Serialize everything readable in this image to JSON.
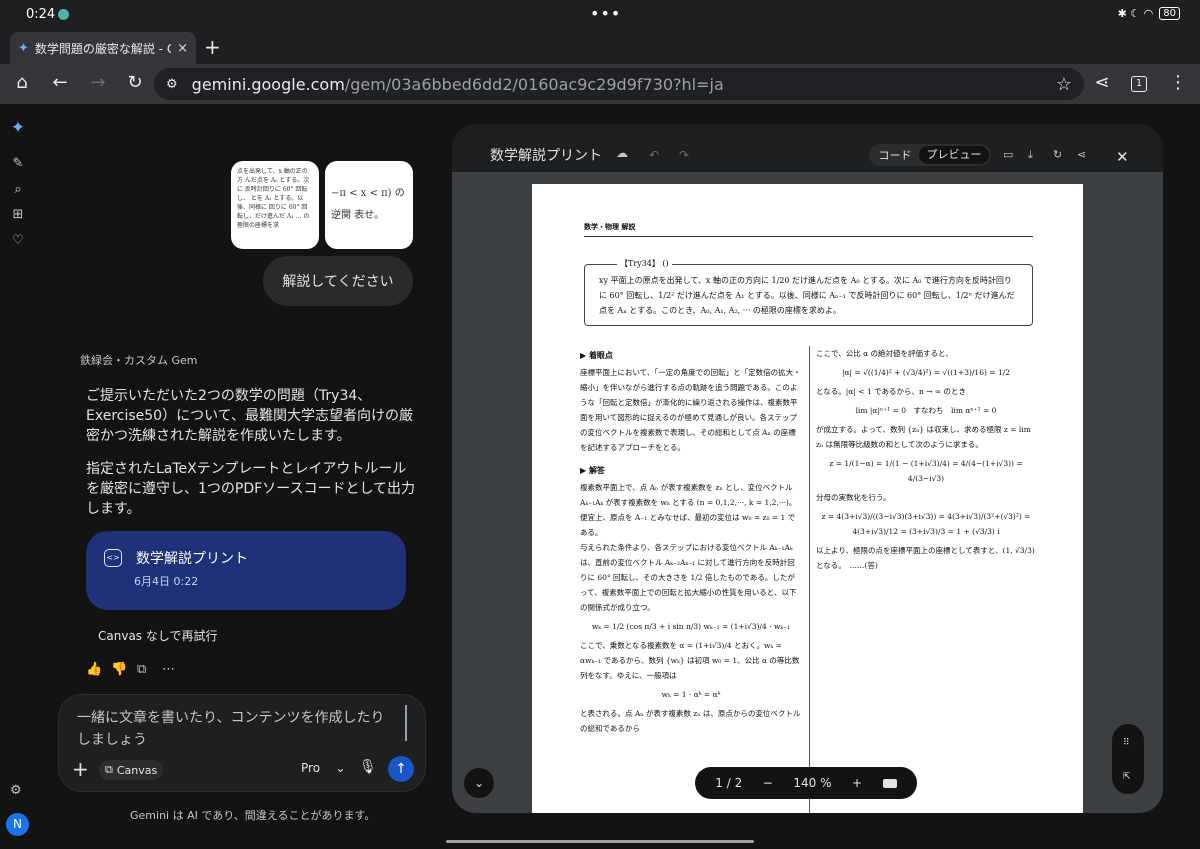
{
  "status": {
    "time": "0:24",
    "dots": "•••",
    "icons": "✱ ☾ ◠",
    "battery": "80"
  },
  "tab": {
    "title": "数学問題の厳密な解説 - Go",
    "close": "×",
    "new": "+"
  },
  "omnibox": {
    "url_host": "gemini.google.com",
    "url_rest": "/gem/03a6bbed6dd2/0160ac9c29d9f730?hl=ja",
    "tab_count": "1"
  },
  "chat": {
    "thumb1_text": "点を出発して、x 軸の正の方 んだ点を A₀ とする。次に 反時計回りに 60° 回転し、 とを A₁ とする。以後、同様に 回りに 60° 回転し、だけ進んだ A₁ … の極限の座標を求",
    "thumb2_text": "−π < x < π) の逆関 表せ。",
    "user_message": "解説してください",
    "gem_label": "鉄緑会・カスタム Gem",
    "reply_p1": "ご提示いただいた2つの数学の問題（Try34、Exercise50）について、最難関大学志望者向けの厳密かつ洗練された解説を作成いたします。",
    "reply_p2": "指定されたLaTeXテンプレートとレイアウトルールを厳密に遵守し、1つのPDFソースコードとして出力します。",
    "canvas_card": {
      "title": "数学解説プリント",
      "date": "6月4日 0:22",
      "icon": "<>"
    },
    "retry": "Canvas なしで再試行",
    "action_icons": [
      "👍",
      "👎",
      "⧉",
      "⋯"
    ]
  },
  "input": {
    "placeholder": "一緒に文章を書いたり、コンテンツを作成したりしましょう",
    "canvas_chip": "Canvas",
    "model": "Pro",
    "model_chevron": "⌄"
  },
  "disclaimer": "Gemini は AI であり、間違えることがあります。",
  "avatar": "N",
  "panel": {
    "title": "数学解説プリント",
    "seg_code": "コード",
    "seg_preview": "プレビュー",
    "page_indicator": "1 / 2",
    "zoom_minus": "−",
    "zoom": "140 %",
    "zoom_plus": "+"
  },
  "doc": {
    "header": "数学・物理 解説",
    "problem_tag": "【Try34】 ()",
    "problem_text": "xy 平面上の原点を出発して、x 軸の正の方向に 1/20 だけ進んだ点を A₀ とする。次に A₀ で進行方向を反時計回りに 60° 回転し、1/2² だけ進んだ点を A₁ とする。以後、同様に Aₙ₋₁ で反時計回りに 60° 回転し、1/2ⁿ だけ進んだ点を Aₙ とする。このとき、A₀, A₁, A₂, ··· の極限の座標を求めよ。",
    "sec1": "▶ 着眼点",
    "sec1_text": "座標平面上において、「一定の角度での回転」と「定数倍の拡大・縮小」を伴いながら進行する点の軌跡を追う問題である。このような「回転と定数倍」が漸化的に繰り返される操作は、複素数平面を用いて図形的に捉えるのが極めて見通しが良い。各ステップの変位ベクトルを複素数で表現し、その総和として点 Aₙ の座標を記述するアプローチをとる。",
    "sec2": "▶ 解答",
    "sec2_text1": "複素数平面上で、点 Aₙ が表す複素数を zₙ とし、変位ベクトル Aₖ₋₁Aₖ が表す複素数を wₖ とする (n = 0,1,2,···, k = 1,2,···)。便宜上、原点を A₋₁ とみなせば、最初の変位は w₀ = z₀ = 1 である。",
    "sec2_text2": "与えられた条件より、各ステップにおける変位ベクトル Aₖ₋₁Aₖ は、直前の変位ベクトル Aₖ₋₂Aₖ₋₁ に対して進行方向を反時計回りに 60° 回転し、その大きさを 1/2 倍したものである。したがって、複素数平面上での回転と拡大縮小の性質を用いると、以下の関係式が成り立つ。",
    "eq1": "wₖ = 1/2 (cos π/3 + i sin π/3) wₖ₋₁ = (1+i√3)/4 · wₖ₋₁",
    "sec2_text3": "ここで、乗数となる複素数を α = (1+i√3)/4 とおく。wₖ = αwₖ₋₁ であるから、数列 {wₖ} は初項 w₀ = 1、公比 α の等比数列をなす。ゆえに、一般項は",
    "eq2": "wₖ = 1 · αᵏ = αᵏ",
    "sec2_text4": "と表される。点 Aₙ が表す複素数 zₙ は、原点からの変位ベクトルの総和であるから",
    "r1": "ここで、公比 α の絶対値を評価すると、",
    "eq3": "|α| = √((1/4)² + (√3/4)²) = √((1+3)/16) = 1/2",
    "r2": "となる。|α| < 1 であるから、n → ∞ のとき",
    "eq4": "lim |α|ⁿ⁺¹ = 0　すなわち　lim αⁿ⁺¹ = 0",
    "r3": "が成立する。よって、数列 {zₙ} は収束し、求める極限 z = lim zₙ は無限等比級数の和として次のように求まる。",
    "eq5": "z = 1/(1−α) = 1/(1 − (1+i√3)/4) = 4/(4−(1+i√3)) = 4/(3−i√3)",
    "r4": "分母の実数化を行う。",
    "eq6": "z = 4(3+i√3)/((3−i√3)(3+i√3)) = 4(3+i√3)/(3²+(√3)²) = 4(3+i√3)/12 = (3+i√3)/3 = 1 + (√3/3) i",
    "r5": "以上より、極限の点を座標平面上の座標として表すと、(1, √3/3) となる。　……(答)"
  }
}
